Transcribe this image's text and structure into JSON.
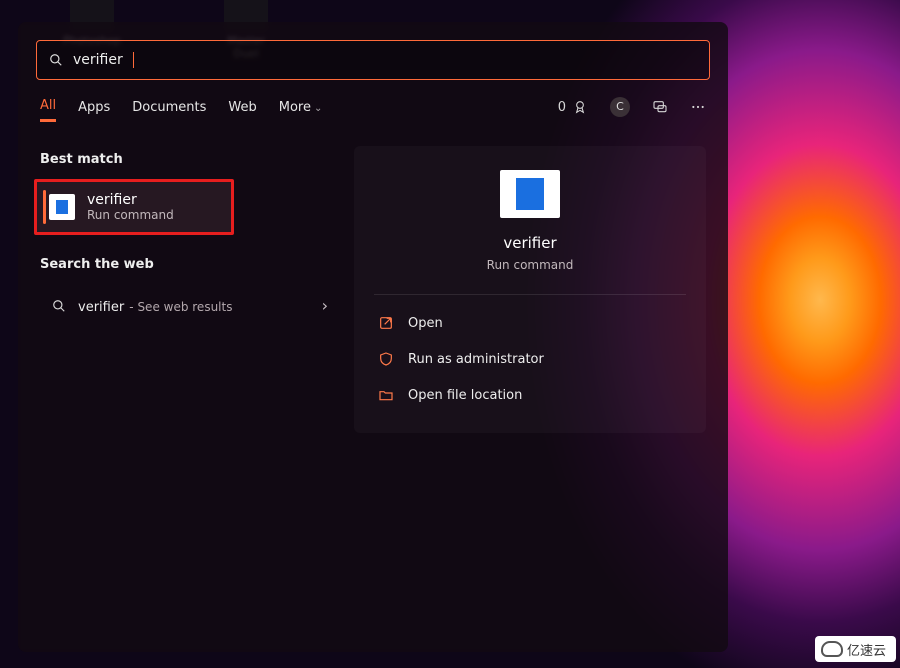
{
  "desktop_icons": [
    "Photoshop",
    "Master Duel"
  ],
  "search": {
    "value": "verifier"
  },
  "tabs": {
    "items": [
      "All",
      "Apps",
      "Documents",
      "Web"
    ],
    "more_label": "More",
    "active_index": 0
  },
  "toolbar": {
    "points": "0",
    "avatar_initial": "C"
  },
  "sections": {
    "best_match": "Best match",
    "search_web": "Search the web"
  },
  "best_result": {
    "title": "verifier",
    "subtitle": "Run command"
  },
  "web_result": {
    "term": "verifier",
    "suffix": "See web results"
  },
  "detail": {
    "title": "verifier",
    "subtitle": "Run command"
  },
  "actions": {
    "open": "Open",
    "run_admin": "Run as administrator",
    "open_location": "Open file location"
  },
  "watermark": "亿速云"
}
